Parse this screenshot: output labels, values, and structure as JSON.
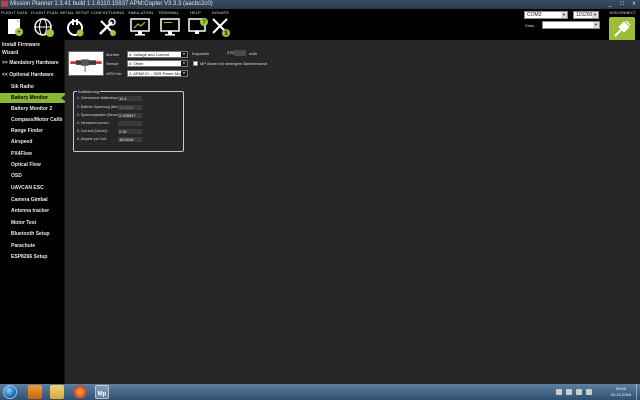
{
  "window": {
    "title": "Mission Planner 1.3.41 build 1.1.6110.15937 APM:Copter V3.3.3 (aacbc2c0)",
    "buttons": [
      "_",
      "□",
      "x"
    ]
  },
  "toolbar": {
    "menu": [
      {
        "label": "Flight Data",
        "icon": "flight-data-icon"
      },
      {
        "label": "Flight Plan",
        "icon": "globe-icon"
      },
      {
        "label": "Initial Setup",
        "icon": "plug-icon"
      },
      {
        "label": "Config/Tuning",
        "icon": "wrench-screwdriver-icon"
      },
      {
        "label": "Simulation",
        "icon": "monitor-icon"
      },
      {
        "label": "Terminal",
        "icon": "terminal-monitor-icon"
      },
      {
        "label": "Help",
        "icon": "help-monitor-icon"
      },
      {
        "label": "Donate",
        "icon": "donate-plane-icon"
      }
    ],
    "port": "COM3",
    "baud": "115200",
    "stats_label": "Stats...",
    "disconnect_label": "DISCONNECT"
  },
  "sidebar": {
    "items": [
      {
        "label": "Install Firmware",
        "level": 0
      },
      {
        "label": "Wizard",
        "level": 0
      },
      {
        "label": ">> Mandatory Hardware",
        "level": 0
      },
      {
        "label": "<< Optional Hardware",
        "level": 0
      },
      {
        "label": "Sik Radio",
        "level": 1
      },
      {
        "label": "Battery Monitor",
        "level": 1,
        "active": true
      },
      {
        "label": "Battery Monitor 2",
        "level": 1
      },
      {
        "label": "Compass/Motor Calib",
        "level": 1
      },
      {
        "label": "Range Finder",
        "level": 1
      },
      {
        "label": "Airspeed",
        "level": 1
      },
      {
        "label": "PX4Flow",
        "level": 1
      },
      {
        "label": "Optical Flow",
        "level": 1
      },
      {
        "label": "OSD",
        "level": 1
      },
      {
        "label": "UAVCAN ESC",
        "level": 1
      },
      {
        "label": "Camera Gimbal",
        "level": 1
      },
      {
        "label": "Antenna tracker",
        "level": 1
      },
      {
        "label": "Motor Test",
        "level": 1
      },
      {
        "label": "Bluetooth Setup",
        "level": 1
      },
      {
        "label": "Parachute",
        "level": 1
      },
      {
        "label": "ESP8266 Setup",
        "level": 1
      }
    ]
  },
  "battery": {
    "monitor_label": "Monitor",
    "monitor_value": "4: Voltage and Current",
    "sensor_label": "Sensor",
    "sensor_value": "0: Other",
    "apm_label": "APM Ver",
    "apm_value": "2: APM2.5+ - 3DR Power Mo",
    "capacity_label": "Kapazität",
    "capacity_value": "2700",
    "capacity_unit": "mAh",
    "alarm_label": "MP Alarm bei niedrigem Batteriestand"
  },
  "calibration": {
    "title": "Kalibrierung",
    "rows": [
      {
        "label": "1. Gemessene Batteriespannung:",
        "value": "11.4",
        "dim": false
      },
      {
        "label": "2. Batterie Spannung (Berechnet):",
        "value": "11.0025",
        "dim": true
      },
      {
        "label": "3. Spannungsteiler (Berechnet):",
        "value": "2.239947",
        "dim": false
      },
      {
        "label": "4. Measured current:",
        "value": "",
        "dim": true
      },
      {
        "label": "5. Current (Calced):",
        "value": "0.31",
        "dim": false
      },
      {
        "label": "6. Ampere pro Volt:",
        "value": "18.0018",
        "dim": false
      }
    ]
  },
  "taskbar": {
    "time": "09:40",
    "date": "02.10.2016"
  }
}
